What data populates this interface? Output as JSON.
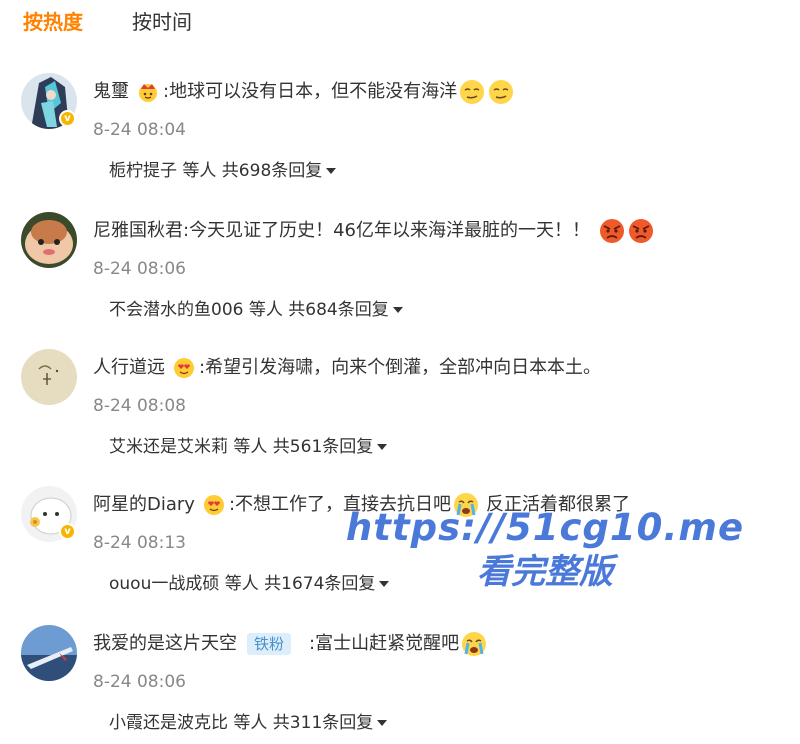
{
  "tabs": {
    "hot": "按热度",
    "time": "按时间"
  },
  "colors": {
    "accent": "#ff8200",
    "watermark": "#3c6ed6",
    "fan_tag_bg": "#dceefb",
    "fan_tag_text": "#4a90c9"
  },
  "comments": [
    {
      "user": "鬼璽",
      "badge_icon": "crown-emoji",
      "text": ":地球可以没有日本，但不能没有海洋",
      "emoji_icons": [
        "smirk-emoji",
        "smirk-emoji"
      ],
      "time": "8-24 08:04",
      "replies": "栀柠提子 等人 共698条回复"
    },
    {
      "user": "尼雅国秋君",
      "text": ":今天见证了历史！46亿年以来海洋最脏的一天！！",
      "emoji_icons": [
        "angry-emoji",
        "angry-emoji"
      ],
      "time": "8-24 08:06",
      "replies": "不会潜水的鱼006 等人 共684条回复"
    },
    {
      "user": "人行道远",
      "badge_icon": "heart-eyes-emoji",
      "text": ":希望引发海啸，向来个倒灌，全部冲向日本本土。",
      "time": "8-24 08:08",
      "replies": "艾米还是艾米莉 等人 共561条回复"
    },
    {
      "user": "阿星的Diary",
      "badge_icon": "heart-eyes-emoji",
      "text": ":不想工作了，直接去抗日吧",
      "emoji_icons": [
        "crying-emoji"
      ],
      "text_after": "反正活着都很累了",
      "time": "8-24 08:13",
      "replies": "ouou一战成硕 等人 共1674条回复"
    },
    {
      "user": "我爱的是这片天空",
      "fan_tag": "铁粉",
      "text": ":富士山赶紧觉醒吧",
      "emoji_icons": [
        "crying-emoji"
      ],
      "time": "8-24 08:06",
      "replies": "小霞还是波克比 等人 共311条回复"
    }
  ],
  "watermark": {
    "line1": "https://51cg10.me",
    "line2": "看完整版"
  }
}
